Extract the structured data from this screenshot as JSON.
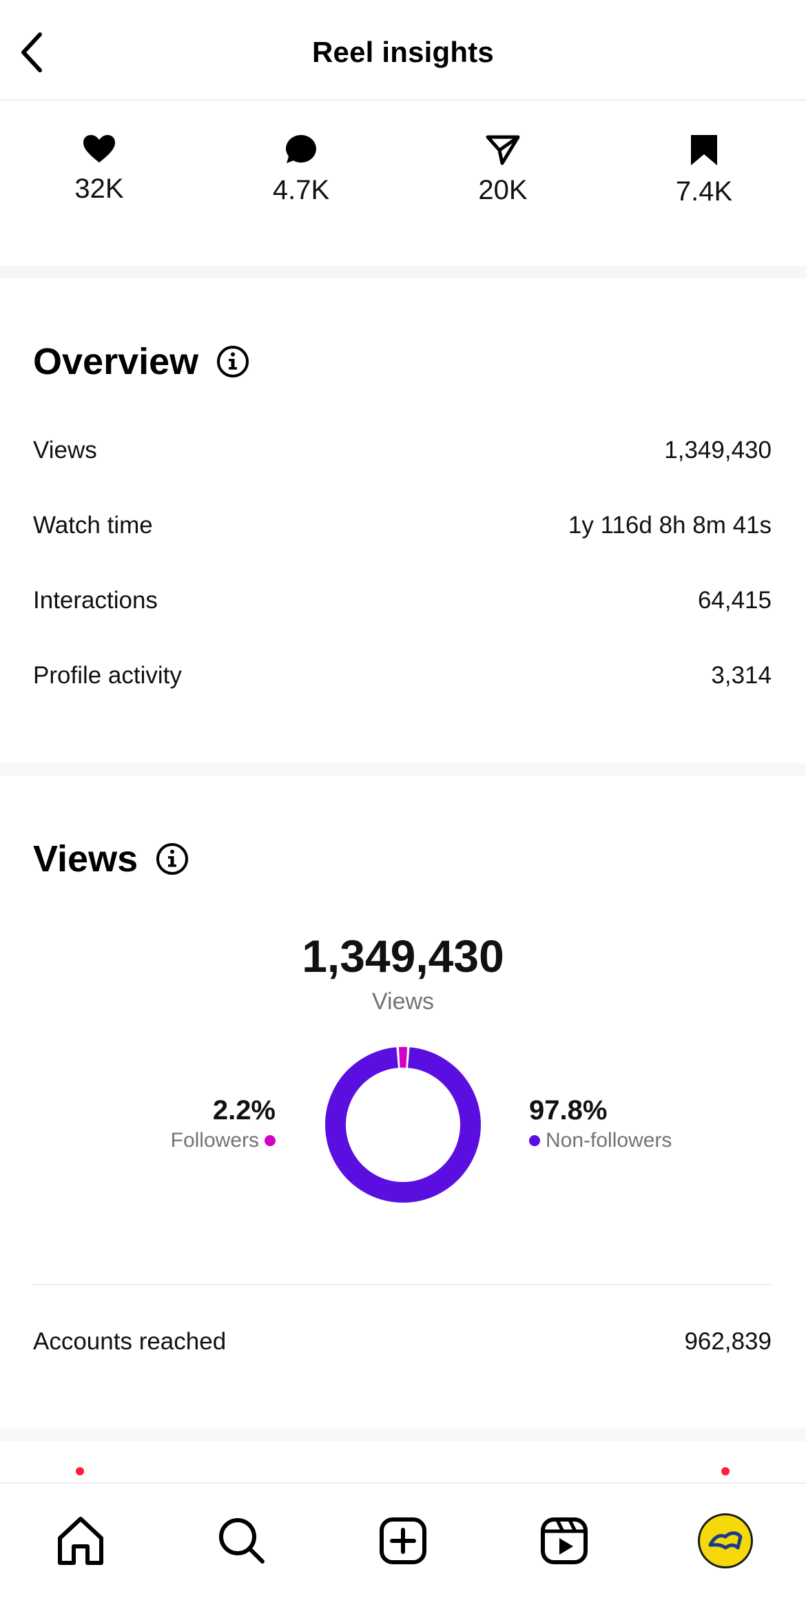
{
  "header": {
    "title": "Reel insights",
    "back_icon": "chevron-left-icon"
  },
  "stats": [
    {
      "icon": "heart-icon",
      "value": "32K"
    },
    {
      "icon": "comment-icon",
      "value": "4.7K"
    },
    {
      "icon": "share-icon",
      "value": "20K"
    },
    {
      "icon": "bookmark-icon",
      "value": "7.4K"
    }
  ],
  "overview": {
    "title": "Overview",
    "rows": [
      {
        "label": "Views",
        "value": "1,349,430"
      },
      {
        "label": "Watch time",
        "value": "1y 116d 8h 8m 41s"
      },
      {
        "label": "Interactions",
        "value": "64,415"
      },
      {
        "label": "Profile activity",
        "value": "3,314"
      }
    ]
  },
  "views": {
    "title": "Views",
    "total": "1,349,430",
    "total_label": "Views",
    "accounts_reached_label": "Accounts reached",
    "accounts_reached_value": "962,839"
  },
  "chart_data": {
    "type": "pie",
    "categories": [
      "Followers",
      "Non-followers"
    ],
    "values": [
      2.2,
      97.8
    ],
    "labels": [
      "2.2%",
      "97.8%"
    ],
    "colors": [
      "#d300c5",
      "#5a0fe0"
    ]
  },
  "nav": {
    "items": [
      "home-icon",
      "search-icon",
      "create-icon",
      "reels-icon",
      "profile-avatar"
    ]
  },
  "colors": {
    "accent_purple": "#5a0fe0",
    "accent_magenta": "#d300c5",
    "notification_red": "#ff1f3d"
  }
}
